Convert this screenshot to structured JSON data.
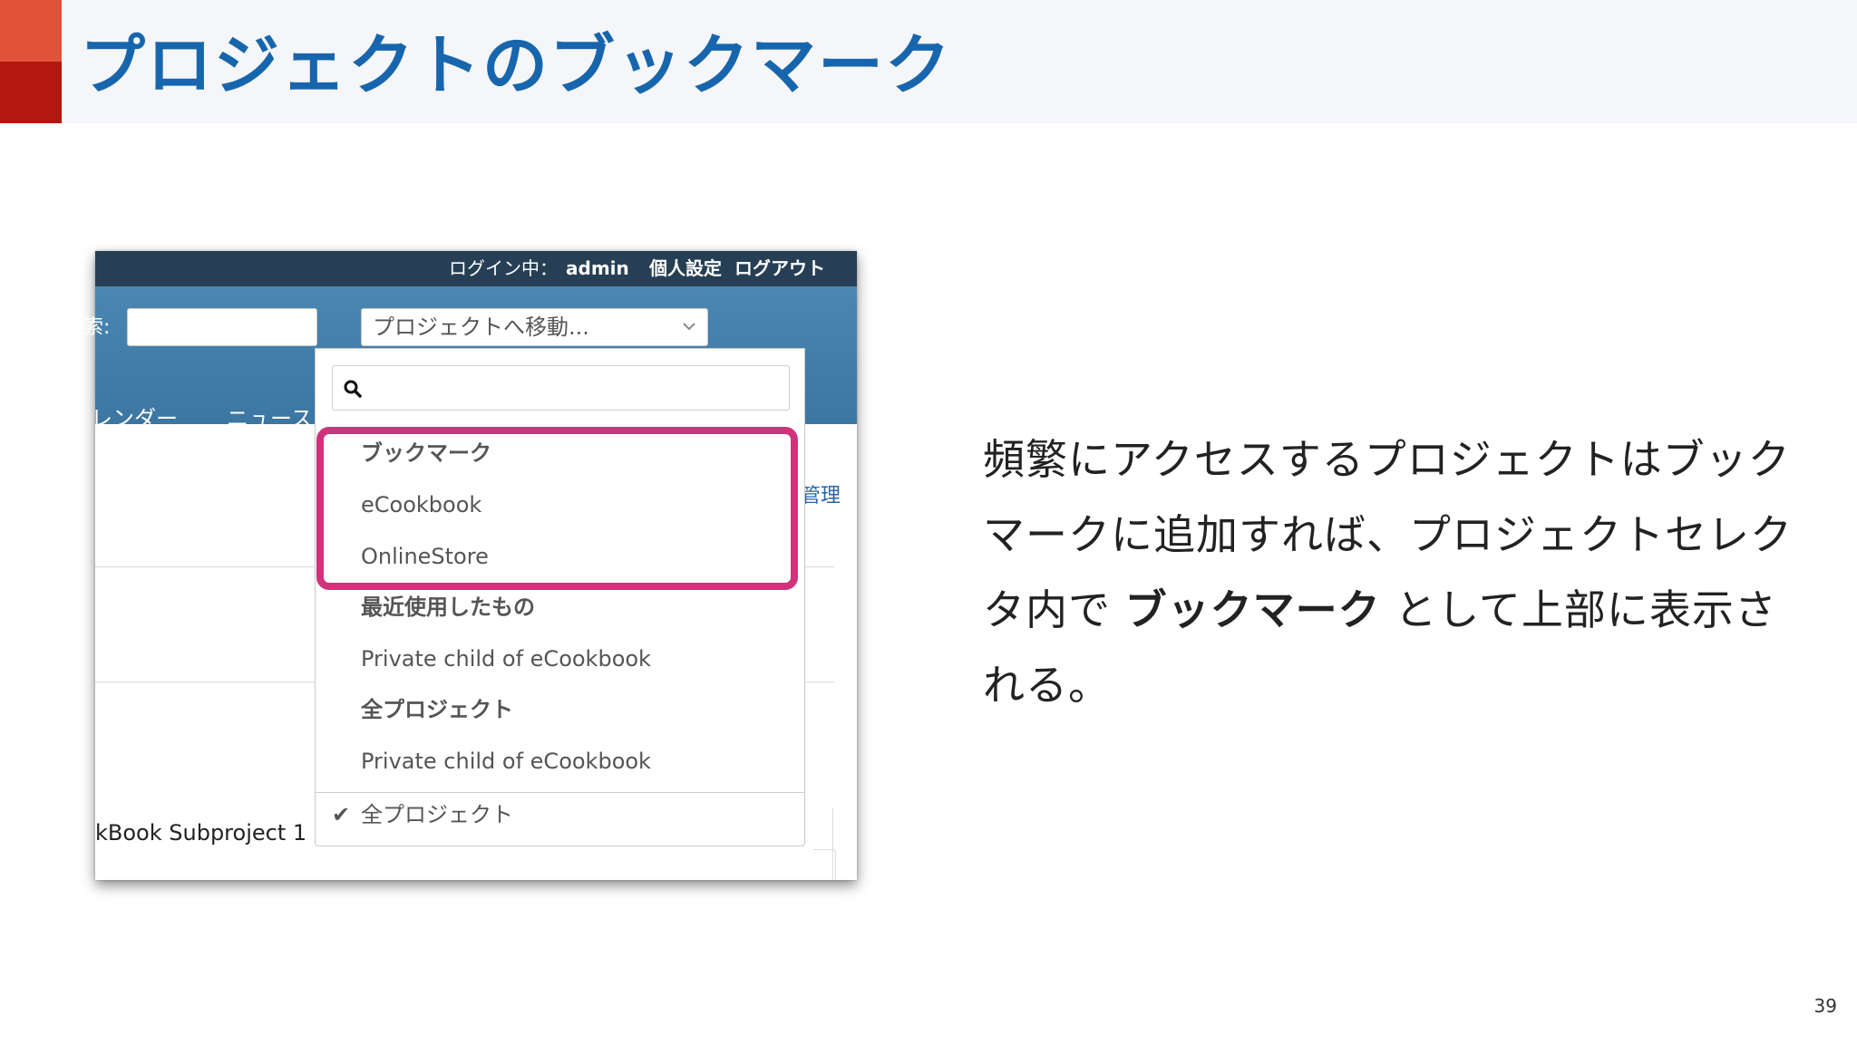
{
  "slide": {
    "title": "プロジェクトのブックマーク",
    "page_number": "39",
    "colors": {
      "title": "#1766ad",
      "accent_light": "#e0533a",
      "accent_dark": "#b3170f",
      "highlight": "#d1327c"
    }
  },
  "topbar": {
    "login_label": "ログイン中：",
    "user": "admin",
    "my_account": "個人設定",
    "logout": "ログアウト"
  },
  "header": {
    "search_label": "検索:",
    "search_value": "",
    "project_jump_placeholder": "プロジェクトへ移動...",
    "menu_items": [
      "レンダー",
      "ニュース"
    ]
  },
  "background": {
    "side_link": "管理",
    "row_text": "kBook Subproject 1"
  },
  "dropdown": {
    "search_value": "",
    "groups": [
      {
        "label": "ブックマーク",
        "items": [
          "eCookbook",
          "OnlineStore"
        ]
      },
      {
        "label": "最近使用したもの",
        "items": [
          "Private child of eCookbook"
        ]
      },
      {
        "label": "全プロジェクト",
        "items": [
          "Private child of eCookbook"
        ]
      }
    ],
    "footer": {
      "check": "✔",
      "label": "全プロジェクト"
    }
  },
  "description": {
    "text_before": "頻繁にアクセスするプロジェクトはブックマークに追加すれば、プロジェクトセレクタ内で ",
    "emphasis": "ブックマーク",
    "text_after": " として上部に表示される。"
  }
}
